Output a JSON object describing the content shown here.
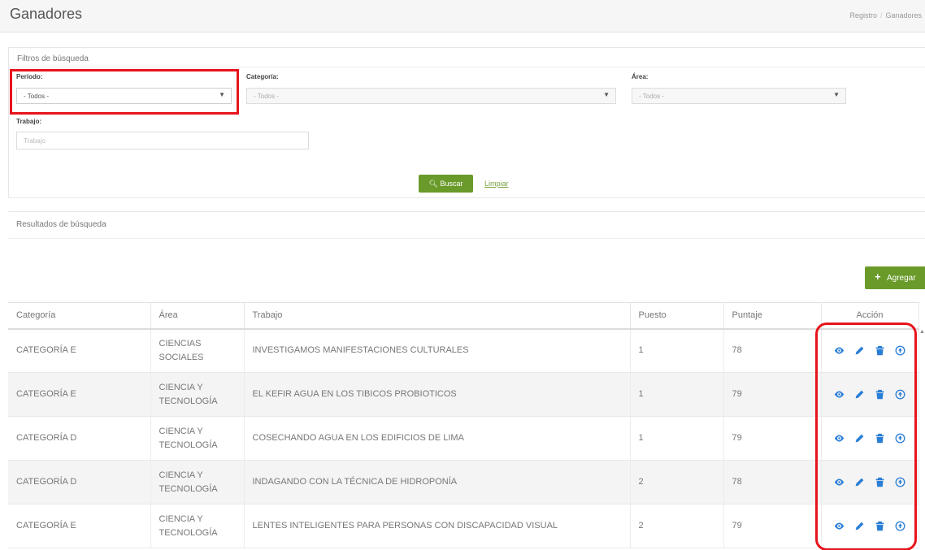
{
  "header": {
    "title": "Ganadores",
    "breadcrumb": [
      "Registro",
      "Ganadores"
    ]
  },
  "filters": {
    "title": "Filtros de búsqueda",
    "periodo": {
      "label": "Periodo:",
      "value": "- Todos -"
    },
    "categoria": {
      "label": "Categoría:",
      "value": "- Todos -"
    },
    "area": {
      "label": "Área:",
      "value": "- Todos -"
    },
    "trabajo": {
      "label": "Trabajo:",
      "placeholder": "Trabajo"
    },
    "search_button": "Buscar",
    "clear_link": "Limpiar"
  },
  "results": {
    "title": "Resultados de búsqueda",
    "add_button": "Agregar",
    "columns": [
      "Categoría",
      "Área",
      "Trabajo",
      "Puesto",
      "Puntaje",
      "Acción"
    ],
    "rows": [
      {
        "categoria": "CATEGORÍA E",
        "area": "CIENCIAS SOCIALES",
        "trabajo": "INVESTIGAMOS MANIFESTACIONES CULTURALES",
        "puesto": "1",
        "puntaje": "78"
      },
      {
        "categoria": "CATEGORÍA E",
        "area": "CIENCIA Y TECNOLOGÍA",
        "trabajo": "EL KEFIR AGUA EN LOS TIBICOS PROBIOTICOS",
        "puesto": "1",
        "puntaje": "79"
      },
      {
        "categoria": "CATEGORÍA D",
        "area": "CIENCIA Y TECNOLOGÍA",
        "trabajo": "COSECHANDO AGUA EN LOS EDIFICIOS DE LIMA",
        "puesto": "1",
        "puntaje": "79"
      },
      {
        "categoria": "CATEGORÍA D",
        "area": "CIENCIA Y TECNOLOGÍA",
        "trabajo": "INDAGANDO CON LA TÉCNICA DE HIDROPONÍA",
        "puesto": "2",
        "puntaje": "78"
      },
      {
        "categoria": "CATEGORÍA E",
        "area": "CIENCIA Y TECNOLOGÍA",
        "trabajo": "LENTES INTELIGENTES PARA PERSONAS CON DISCAPACIDAD VISUAL",
        "puesto": "2",
        "puntaje": "79"
      }
    ],
    "row_actions": [
      "eye-icon",
      "pencil-icon",
      "trash-icon",
      "arrow-up-circle-icon"
    ]
  },
  "colors": {
    "accent_green": "#6a9a2a",
    "action_blue": "#2a7ed6",
    "highlight_red": "#e8141c"
  }
}
